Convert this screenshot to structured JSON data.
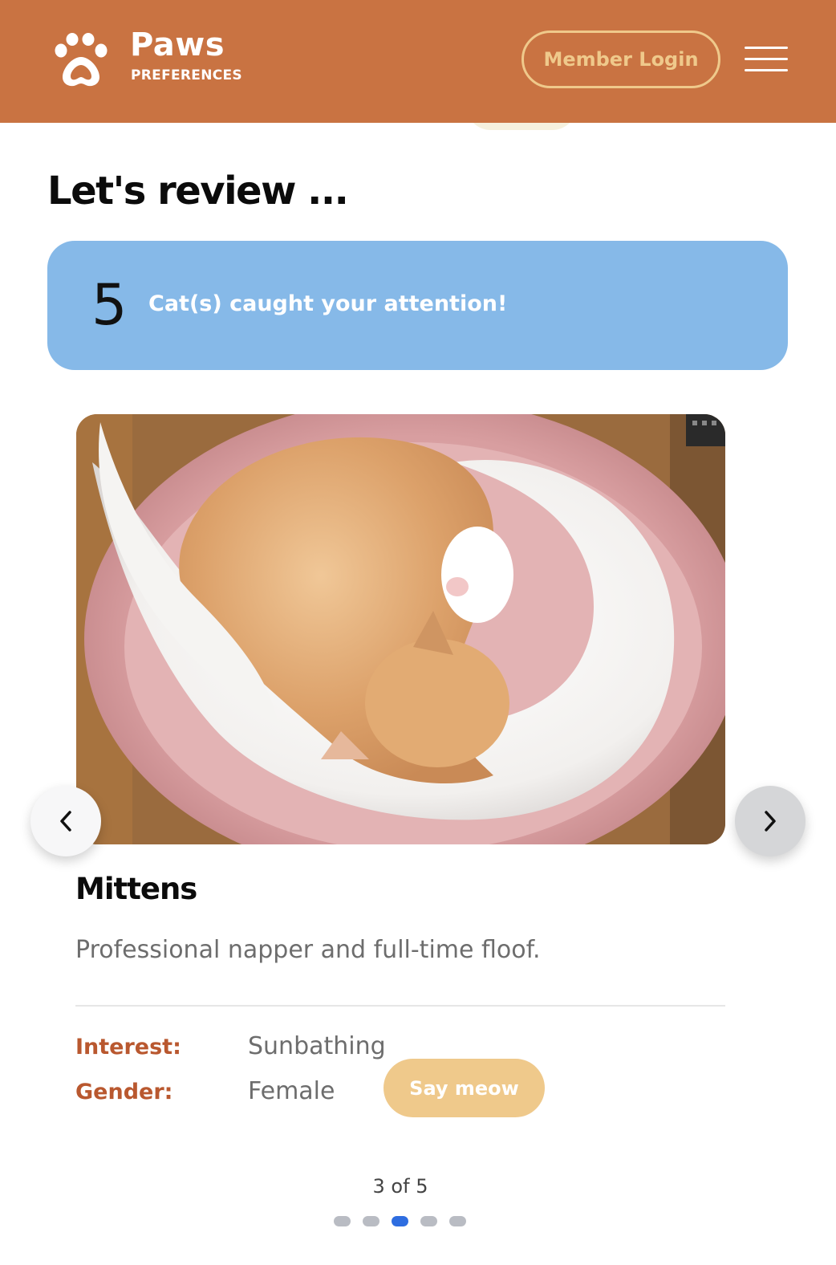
{
  "header": {
    "brand_name": "Paws",
    "brand_sub": "PREFERENCES",
    "login_label": "Member Login",
    "background_color": "#c97342",
    "accent_color": "#efc98b"
  },
  "main": {
    "title": "Let's review ...",
    "count": "5",
    "count_text": "Cat(s) caught your attention!",
    "banner_color": "#86b9e8"
  },
  "cat": {
    "name": "Mittens",
    "description": "Professional napper and full-time floof.",
    "interest_label": "Interest:",
    "interest_value": "Sunbathing",
    "gender_label": "Gender:",
    "gender_value": "Female",
    "meow_label": "Say meow"
  },
  "pager": {
    "text": "3 of 5",
    "total": 5,
    "current": 3,
    "active_color": "#2e6de0"
  },
  "icons": {
    "logo": "paw-icon",
    "menu": "hamburger-icon",
    "prev": "chevron-left-icon",
    "next": "chevron-right-icon"
  }
}
